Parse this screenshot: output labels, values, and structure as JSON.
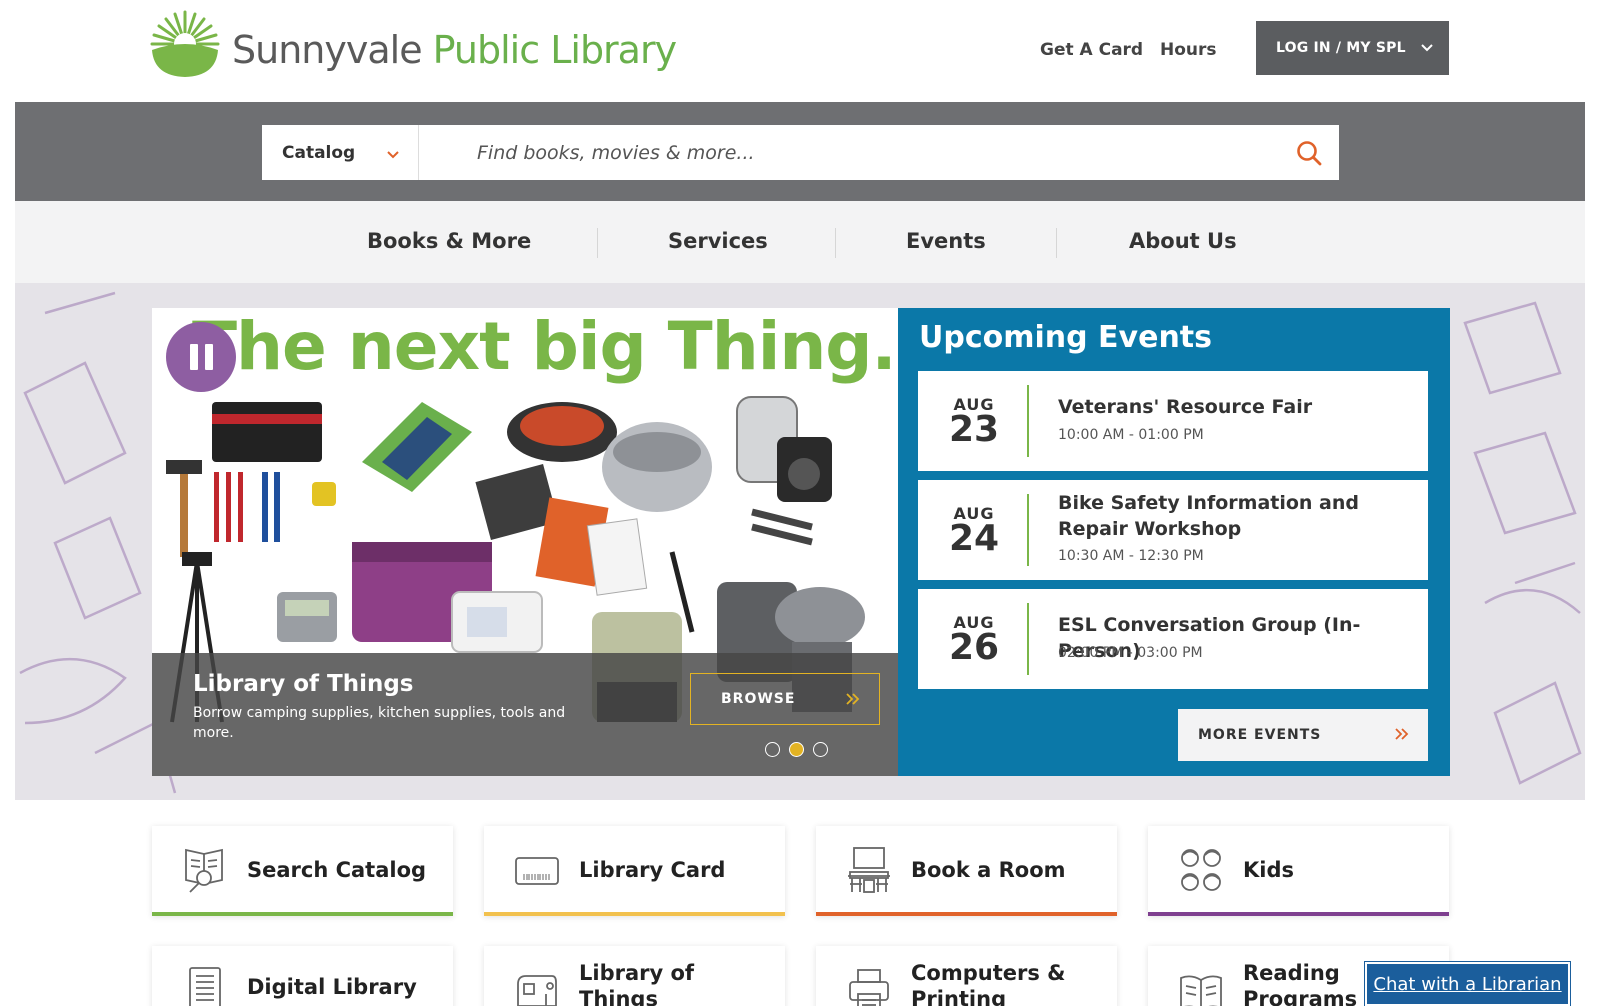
{
  "site": {
    "name_part1": "Sunnyvale",
    "name_part2": "Public Library"
  },
  "header": {
    "links": [
      {
        "label": "Get A Card"
      },
      {
        "label": "Hours"
      }
    ],
    "login_label": "LOG IN / MY SPL"
  },
  "search": {
    "scope": "Catalog",
    "placeholder": "Find books, movies & more..."
  },
  "nav": {
    "items": [
      {
        "label": "Books & More"
      },
      {
        "label": "Services"
      },
      {
        "label": "Events"
      },
      {
        "label": "About Us"
      }
    ]
  },
  "slide": {
    "headline": "The next big Thing.",
    "caption_title": "Library of Things",
    "caption_desc": "Borrow camping supplies, kitchen supplies, tools and more.",
    "button_label": "BROWSE",
    "current_slide": 2,
    "total_slides": 3
  },
  "events": {
    "title": "Upcoming Events",
    "items": [
      {
        "month": "AUG",
        "day": "23",
        "title": "Veterans' Resource Fair",
        "time": "10:00 AM - 01:00 PM"
      },
      {
        "month": "AUG",
        "day": "24",
        "title": "Bike Safety Information and Repair Workshop",
        "time": "10:30 AM - 12:30 PM"
      },
      {
        "month": "AUG",
        "day": "26",
        "title": "ESL Conversation Group (In-Person)",
        "time": "02:00 PM - 03:00 PM"
      }
    ],
    "more_label": "MORE EVENTS"
  },
  "quick_links": [
    {
      "label": "Search Catalog",
      "icon": "catalog-search-icon",
      "color": "#7ab648"
    },
    {
      "label": "Library Card",
      "icon": "library-card-icon",
      "color": "#f2c14e"
    },
    {
      "label": "Book a Room",
      "icon": "meeting-room-icon",
      "color": "#e0622a"
    },
    {
      "label": "Kids",
      "icon": "kids-icon",
      "color": "#7e3f8f"
    },
    {
      "label": "Digital Library",
      "icon": "ebook-reader-icon",
      "color": "#7ab648"
    },
    {
      "label": "Library of Things",
      "icon": "sewing-machine-icon",
      "color": "#f2c14e"
    },
    {
      "label": "Computers & Printing",
      "icon": "printer-icon",
      "color": "#e0622a"
    },
    {
      "label": "Reading Programs",
      "icon": "open-book-icon",
      "color": "#7e3f8f"
    }
  ],
  "chat": {
    "label": "Chat with a Librarian"
  },
  "colors": {
    "brand_green": "#7ab648",
    "gray_band": "#6e6f72",
    "events_blue": "#0b78a8",
    "accent_orange": "#e0622a",
    "accent_yellow": "#e3b323",
    "accent_purple": "#8e5ea2"
  }
}
